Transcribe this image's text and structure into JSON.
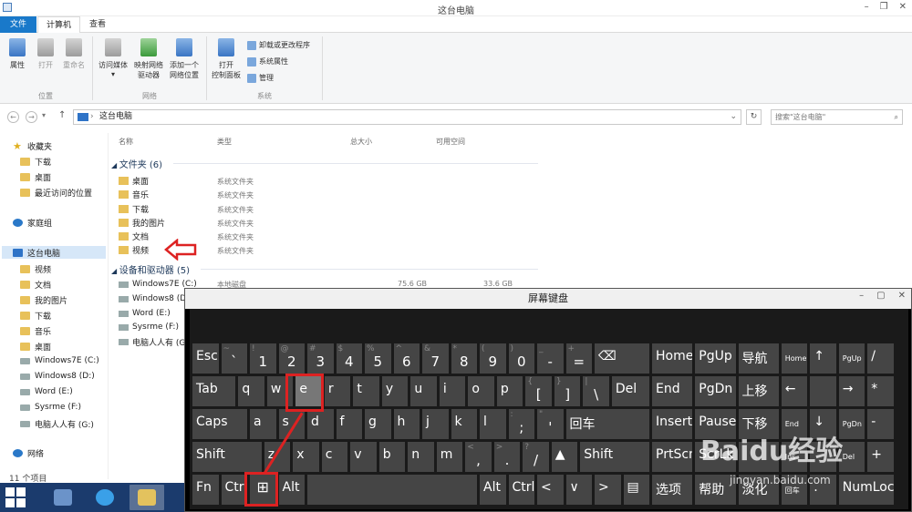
{
  "window": {
    "title": "这台电脑"
  },
  "tabs": [
    "文件",
    "计算机",
    "查看"
  ],
  "ribbon": {
    "location": {
      "items": [
        "属性",
        "打开",
        "重命名"
      ],
      "label": "位置"
    },
    "network": {
      "items": [
        [
          "访问媒体",
          ""
        ],
        [
          "映射网络",
          "驱动器"
        ],
        [
          "添加一个",
          "网络位置"
        ]
      ],
      "label": "网络"
    },
    "system": {
      "open_cp": [
        "打开",
        "控制面板"
      ],
      "small": [
        "卸载或更改程序",
        "系统属性",
        "管理"
      ],
      "label": "系统"
    }
  },
  "address": {
    "path": "这台电脑",
    "search_placeholder": "搜索\"这台电脑\""
  },
  "nav": {
    "favorites": "收藏夹",
    "fav_items": [
      "下载",
      "桌面",
      "最近访问的位置"
    ],
    "homegroup": "家庭组",
    "thispc": "这台电脑",
    "pc_items": [
      "视频",
      "文档",
      "我的图片",
      "下载",
      "音乐",
      "桌面",
      "Windows7E (C:)",
      "Windows8 (D:)",
      "Word (E:)",
      "Sysrme (F:)",
      "电脑人人有 (G:)"
    ],
    "network": "网络"
  },
  "columns": [
    "名称",
    "类型",
    "总大小",
    "可用空间"
  ],
  "folders": {
    "header": "文件夹 (6)",
    "items": [
      {
        "name": "桌面",
        "type": "系统文件夹"
      },
      {
        "name": "音乐",
        "type": "系统文件夹"
      },
      {
        "name": "下载",
        "type": "系统文件夹"
      },
      {
        "name": "我的图片",
        "type": "系统文件夹"
      },
      {
        "name": "文档",
        "type": "系统文件夹"
      },
      {
        "name": "视频",
        "type": "系统文件夹"
      }
    ]
  },
  "drives": {
    "header": "设备和驱动器 (5)",
    "first_type": "本地磁盘",
    "first_total": "75.6 GB",
    "first_free": "33.6 GB",
    "items": [
      "Windows7E (C:)",
      "Windows8 (D",
      "Word (E:)",
      "Sysrme (F:)",
      "电脑人人有 (G"
    ]
  },
  "status": "11 个项目",
  "osk": {
    "title": "屏幕键盘",
    "keys": [
      {
        "r": 0,
        "c": 0,
        "w": 1,
        "m": "Esc"
      },
      {
        "r": 0,
        "c": 1,
        "w": 1,
        "s": "~",
        "mb": "`"
      },
      {
        "r": 0,
        "c": 2,
        "w": 1,
        "s": "!",
        "mb": "1"
      },
      {
        "r": 0,
        "c": 3,
        "w": 1,
        "s": "@",
        "mb": "2"
      },
      {
        "r": 0,
        "c": 4,
        "w": 1,
        "s": "#",
        "mb": "3"
      },
      {
        "r": 0,
        "c": 5,
        "w": 1,
        "s": "$",
        "mb": "4"
      },
      {
        "r": 0,
        "c": 6,
        "w": 1,
        "s": "%",
        "mb": "5"
      },
      {
        "r": 0,
        "c": 7,
        "w": 1,
        "s": "^",
        "mb": "6"
      },
      {
        "r": 0,
        "c": 8,
        "w": 1,
        "s": "&",
        "mb": "7"
      },
      {
        "r": 0,
        "c": 9,
        "w": 1,
        "s": "*",
        "mb": "8"
      },
      {
        "r": 0,
        "c": 10,
        "w": 1,
        "s": "(",
        "mb": "9"
      },
      {
        "r": 0,
        "c": 11,
        "w": 1,
        "s": ")",
        "mb": "0"
      },
      {
        "r": 0,
        "c": 12,
        "w": 1,
        "s": "_",
        "mb": "-"
      },
      {
        "r": 0,
        "c": 13,
        "w": 1,
        "s": "+",
        "mb": "="
      },
      {
        "r": 0,
        "c": 14,
        "w": 2,
        "m": "⌫"
      },
      {
        "r": 0,
        "c": 16,
        "w": 1.5,
        "m": "Home"
      },
      {
        "r": 0,
        "c": 17.5,
        "w": 1.5,
        "m": "PgUp"
      },
      {
        "r": 0,
        "c": 19,
        "w": 1.5,
        "m": "导航"
      },
      {
        "r": 0,
        "c": 20.5,
        "w": 1,
        "m": "Home",
        "sm": true
      },
      {
        "r": 0,
        "c": 21.5,
        "w": 1,
        "m": "↑"
      },
      {
        "r": 0,
        "c": 22.5,
        "w": 1,
        "m": "PgUp",
        "sm": true
      },
      {
        "r": 0,
        "c": 23.5,
        "w": 1,
        "m": "/"
      },
      {
        "r": 1,
        "c": 0,
        "w": 1.6,
        "m": "Tab"
      },
      {
        "r": 1,
        "c": 1.6,
        "w": 1,
        "m": "q"
      },
      {
        "r": 1,
        "c": 2.6,
        "w": 1,
        "m": "w"
      },
      {
        "r": 1,
        "c": 3.6,
        "w": 1,
        "m": "e",
        "hl": true
      },
      {
        "r": 1,
        "c": 4.6,
        "w": 1,
        "m": "r"
      },
      {
        "r": 1,
        "c": 5.6,
        "w": 1,
        "m": "t"
      },
      {
        "r": 1,
        "c": 6.6,
        "w": 1,
        "m": "y"
      },
      {
        "r": 1,
        "c": 7.6,
        "w": 1,
        "m": "u"
      },
      {
        "r": 1,
        "c": 8.6,
        "w": 1,
        "m": "i"
      },
      {
        "r": 1,
        "c": 9.6,
        "w": 1,
        "m": "o"
      },
      {
        "r": 1,
        "c": 10.6,
        "w": 1,
        "m": "p"
      },
      {
        "r": 1,
        "c": 11.6,
        "w": 1,
        "s": "{",
        "mb": "["
      },
      {
        "r": 1,
        "c": 12.6,
        "w": 1,
        "s": "}",
        "mb": "]"
      },
      {
        "r": 1,
        "c": 13.6,
        "w": 1,
        "s": "|",
        "mb": "\\"
      },
      {
        "r": 1,
        "c": 14.6,
        "w": 1.4,
        "m": "Del"
      },
      {
        "r": 1,
        "c": 16,
        "w": 1.5,
        "m": "End"
      },
      {
        "r": 1,
        "c": 17.5,
        "w": 1.5,
        "m": "PgDn"
      },
      {
        "r": 1,
        "c": 19,
        "w": 1.5,
        "m": "上移"
      },
      {
        "r": 1,
        "c": 20.5,
        "w": 1,
        "m": "←"
      },
      {
        "r": 1,
        "c": 21.5,
        "w": 1,
        "m": ""
      },
      {
        "r": 1,
        "c": 22.5,
        "w": 1,
        "m": "→"
      },
      {
        "r": 1,
        "c": 23.5,
        "w": 1,
        "m": "*"
      },
      {
        "r": 2,
        "c": 0,
        "w": 2,
        "m": "Caps"
      },
      {
        "r": 2,
        "c": 2,
        "w": 1,
        "m": "a"
      },
      {
        "r": 2,
        "c": 3,
        "w": 1,
        "m": "s"
      },
      {
        "r": 2,
        "c": 4,
        "w": 1,
        "m": "d"
      },
      {
        "r": 2,
        "c": 5,
        "w": 1,
        "m": "f"
      },
      {
        "r": 2,
        "c": 6,
        "w": 1,
        "m": "g"
      },
      {
        "r": 2,
        "c": 7,
        "w": 1,
        "m": "h"
      },
      {
        "r": 2,
        "c": 8,
        "w": 1,
        "m": "j"
      },
      {
        "r": 2,
        "c": 9,
        "w": 1,
        "m": "k"
      },
      {
        "r": 2,
        "c": 10,
        "w": 1,
        "m": "l"
      },
      {
        "r": 2,
        "c": 11,
        "w": 1,
        "s": ":",
        "mb": ";"
      },
      {
        "r": 2,
        "c": 12,
        "w": 1,
        "s": "\"",
        "mb": "'"
      },
      {
        "r": 2,
        "c": 13,
        "w": 3,
        "m": "回车"
      },
      {
        "r": 2,
        "c": 16,
        "w": 1.5,
        "m": "Insert"
      },
      {
        "r": 2,
        "c": 17.5,
        "w": 1.5,
        "m": "Pause"
      },
      {
        "r": 2,
        "c": 19,
        "w": 1.5,
        "m": "下移"
      },
      {
        "r": 2,
        "c": 20.5,
        "w": 1,
        "m": "End",
        "sm": true
      },
      {
        "r": 2,
        "c": 21.5,
        "w": 1,
        "m": "↓"
      },
      {
        "r": 2,
        "c": 22.5,
        "w": 1,
        "m": "PgDn",
        "sm": true
      },
      {
        "r": 2,
        "c": 23.5,
        "w": 1,
        "m": "-"
      },
      {
        "r": 3,
        "c": 0,
        "w": 2.5,
        "m": "Shift"
      },
      {
        "r": 3,
        "c": 2.5,
        "w": 1,
        "m": "z"
      },
      {
        "r": 3,
        "c": 3.5,
        "w": 1,
        "m": "x"
      },
      {
        "r": 3,
        "c": 4.5,
        "w": 1,
        "m": "c"
      },
      {
        "r": 3,
        "c": 5.5,
        "w": 1,
        "m": "v"
      },
      {
        "r": 3,
        "c": 6.5,
        "w": 1,
        "m": "b"
      },
      {
        "r": 3,
        "c": 7.5,
        "w": 1,
        "m": "n"
      },
      {
        "r": 3,
        "c": 8.5,
        "w": 1,
        "m": "m"
      },
      {
        "r": 3,
        "c": 9.5,
        "w": 1,
        "s": "<",
        "mb": ","
      },
      {
        "r": 3,
        "c": 10.5,
        "w": 1,
        "s": ">",
        "mb": "."
      },
      {
        "r": 3,
        "c": 11.5,
        "w": 1,
        "s": "?",
        "mb": "/"
      },
      {
        "r": 3,
        "c": 12.5,
        "w": 1,
        "m": "▲"
      },
      {
        "r": 3,
        "c": 13.5,
        "w": 2.5,
        "m": "Shift"
      },
      {
        "r": 3,
        "c": 16,
        "w": 1.5,
        "m": "PrtScn"
      },
      {
        "r": 3,
        "c": 17.5,
        "w": 1.5,
        "m": "ScrLk"
      },
      {
        "r": 3,
        "c": 19,
        "w": 1.5,
        "m": ""
      },
      {
        "r": 3,
        "c": 20.5,
        "w": 1,
        "m": "Ins",
        "sm": true
      },
      {
        "r": 3,
        "c": 21.5,
        "w": 1,
        "m": ""
      },
      {
        "r": 3,
        "c": 22.5,
        "w": 1,
        "m": "Del",
        "sm": true
      },
      {
        "r": 3,
        "c": 23.5,
        "w": 1,
        "m": "+"
      },
      {
        "r": 4,
        "c": 0,
        "w": 1,
        "m": "Fn"
      },
      {
        "r": 4,
        "c": 1,
        "w": 1,
        "m": "Ctrl"
      },
      {
        "r": 4,
        "c": 2,
        "w": 1,
        "m": "⊞",
        "win": true
      },
      {
        "r": 4,
        "c": 3,
        "w": 1,
        "m": "Alt"
      },
      {
        "r": 4,
        "c": 4,
        "w": 6,
        "m": ""
      },
      {
        "r": 4,
        "c": 10,
        "w": 1,
        "m": "Alt"
      },
      {
        "r": 4,
        "c": 11,
        "w": 1,
        "m": "Ctrl"
      },
      {
        "r": 4,
        "c": 12,
        "w": 1,
        "m": "<"
      },
      {
        "r": 4,
        "c": 13,
        "w": 1,
        "m": "∨"
      },
      {
        "r": 4,
        "c": 14,
        "w": 1,
        "m": ">"
      },
      {
        "r": 4,
        "c": 15,
        "w": 1,
        "m": "▤"
      },
      {
        "r": 4,
        "c": 16,
        "w": 1.5,
        "m": "选项"
      },
      {
        "r": 4,
        "c": 17.5,
        "w": 1.5,
        "m": "帮助"
      },
      {
        "r": 4,
        "c": 19,
        "w": 1.5,
        "m": "淡化"
      },
      {
        "r": 4,
        "c": 20.5,
        "w": 1,
        "m": "回车",
        "sm": true
      },
      {
        "r": 4,
        "c": 21.5,
        "w": 1,
        "m": "."
      },
      {
        "r": 4,
        "c": 22.5,
        "w": 2,
        "m": "NumLock"
      }
    ]
  },
  "watermark": {
    "logo": "Baidu经验",
    "url": "jingyan.baidu.com"
  },
  "colors": {
    "accent": "#1979ca",
    "highlight": "#d22222"
  }
}
